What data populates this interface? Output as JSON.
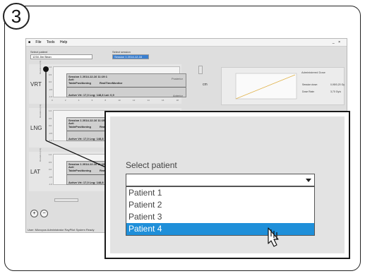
{
  "step_number": "3",
  "menu": [
    "File",
    "Tools",
    "Help"
  ],
  "window_controls": "_ ×",
  "header": {
    "patient_label": "Select patient",
    "patient_value": "1234 Jim Bean",
    "session_label": "Select session",
    "session_value": "Session 1 2014-12-16"
  },
  "rows": [
    {
      "label": "VRT",
      "table": [
        "Session 1 2014-12-16 11:19:1",
        "Acti",
        "TablePositioning",
        "RealTimeMonitor"
      ],
      "right_top": "Posterior",
      "right_bottom": "Anterior",
      "readout": "Active Vrt: 17,0 Lng: 148,8 Lat: 0,9"
    },
    {
      "label": "LNG",
      "table": [
        "Session 1 2014-12-16 11:19:1",
        "Acti",
        "TablePositioning",
        "RealTimeMonitor"
      ],
      "right_top": "",
      "right_bottom": "",
      "readout": "Active Vrt: 17,0 Lng: 148,8"
    },
    {
      "label": "LAT",
      "table": [
        "Session 1 2014-12-16 11:19:1",
        "Acti",
        "TablePositioning",
        "RealTimeMonitor"
      ],
      "right_top": "",
      "right_bottom": "",
      "readout": "Active Vrt: 17,0 Lng: 148,8"
    }
  ],
  "y_ticks": [
    "1.0",
    "0.5",
    "0.0",
    "-0.5",
    "-1.0"
  ],
  "x_ticks": [
    "0",
    "2",
    "4",
    "6",
    "8",
    "10",
    "12",
    "14",
    "16",
    "18"
  ],
  "y_axis_label": "Deviation (cm)",
  "unit_label": "cm",
  "dose_panel": {
    "title": "Administered Dose",
    "y_label": "Dose (Gy)",
    "y_ticks": [
      "0.8",
      "0.6",
      "0.4",
      "0.2",
      "0.0"
    ],
    "x_ticks": [
      "0",
      "5",
      "10",
      "15",
      "20",
      "25",
      "30"
    ],
    "session_dose_label": "Session dose:",
    "session_dose_value": "0,95/0,20 Gy",
    "dose_rate_label": "Dose Rate:",
    "dose_rate_value": "3,70 Gy/s"
  },
  "status_bar": "User: Micropos Administrator   RayPilot System Ready",
  "zoom_in": "+",
  "zoom_out": "−",
  "dropdown": {
    "label": "Select patient",
    "value": "",
    "options": [
      "Patient 1",
      "Patient 2",
      "Patient 3",
      "Patient 4"
    ],
    "highlighted_index": 3
  },
  "colors": {
    "highlight": "#1f8fd9",
    "frame": "#222222",
    "app_bg": "#dedede"
  }
}
